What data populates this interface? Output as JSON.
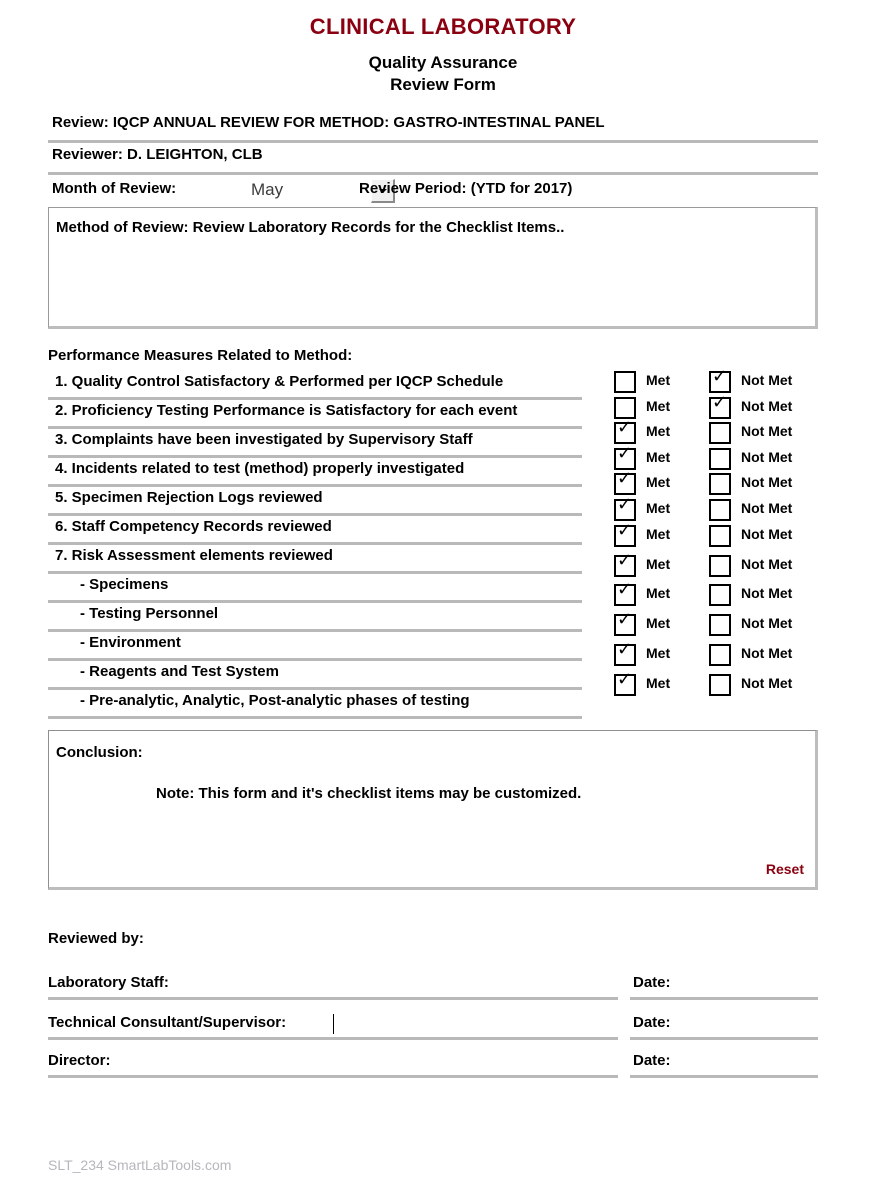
{
  "header": {
    "title": "CLINICAL LABORATORY",
    "subtitle_line1": "Quality Assurance",
    "subtitle_line2": "Review Form",
    "title_color": "#8b0011"
  },
  "fields": {
    "review_label": "Review:  IQCP ANNUAL REVIEW FOR METHOD:  GASTRO-INTESTINAL PANEL",
    "reviewer_label": "Reviewer: D. LEIGHTON, CLB",
    "month_label": "Month of Review:",
    "month_value": "May",
    "period_label": "Review Period:  (YTD for 2017)",
    "method_of_review": "Method of Review:  Review Laboratory Records for the Checklist Items.."
  },
  "measures": {
    "heading": "Performance Measures Related to Method:",
    "met_label": "Met",
    "not_met_label": "Not Met",
    "check_glyph": "✓",
    "items": [
      {
        "label": "1.  Quality Control Satisfactory & Performed per IQCP Schedule",
        "sub": false,
        "met": false,
        "not_met": true
      },
      {
        "label": "2.  Proficiency Testing Performance is Satisfactory for each event",
        "sub": false,
        "met": false,
        "not_met": true
      },
      {
        "label": "3.  Complaints have been investigated by Supervisory Staff",
        "sub": false,
        "met": true,
        "not_met": false
      },
      {
        "label": "4.  Incidents related to test (method) properly investigated",
        "sub": false,
        "met": true,
        "not_met": false
      },
      {
        "label": "5.  Specimen Rejection Logs reviewed",
        "sub": false,
        "met": true,
        "not_met": false
      },
      {
        "label": "6.  Staff Competency Records reviewed",
        "sub": false,
        "met": true,
        "not_met": false
      },
      {
        "label": "7.  Risk Assessment elements reviewed",
        "sub": false,
        "met": true,
        "not_met": false
      },
      {
        "label": "- Specimens",
        "sub": true,
        "met": true,
        "not_met": false
      },
      {
        "label": "- Testing Personnel",
        "sub": true,
        "met": true,
        "not_met": false
      },
      {
        "label": "- Environment",
        "sub": true,
        "met": true,
        "not_met": false
      },
      {
        "label": "- Reagents and Test System",
        "sub": true,
        "met": true,
        "not_met": false
      },
      {
        "label": "- Pre-analytic, Analytic, Post-analytic phases of testing",
        "sub": true,
        "met": true,
        "not_met": false
      }
    ]
  },
  "conclusion": {
    "title": "Conclusion:",
    "note": "Note:  This form and it's checklist items may be customized.",
    "reset_label": "Reset",
    "reset_color": "#8b0011"
  },
  "signatures": {
    "heading": "Reviewed by:",
    "date_label": "Date:",
    "rows": [
      {
        "label": "Laboratory Staff:",
        "value": ""
      },
      {
        "label": "Technical Consultant/Supervisor:",
        "value": ""
      },
      {
        "label": "Director:",
        "value": ""
      }
    ]
  },
  "footer": {
    "text": "SLT_234 SmartLabTools.com"
  }
}
